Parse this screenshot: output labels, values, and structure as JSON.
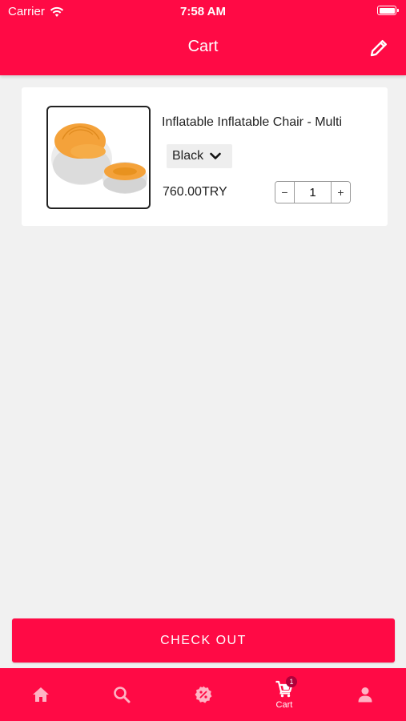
{
  "status_bar": {
    "carrier": "Carrier",
    "time": "7:58 AM"
  },
  "header": {
    "title": "Cart",
    "edit_icon": "pencil-icon"
  },
  "cart_items": [
    {
      "name": "Inflatable Inflatable Chair - Multi",
      "variant": "Black",
      "price": "760.00TRY",
      "quantity": "1",
      "minus_label": "−",
      "plus_label": "+"
    }
  ],
  "checkout_label": "CHECK OUT",
  "tabbar": {
    "items": [
      {
        "icon": "home-icon",
        "label": ""
      },
      {
        "icon": "search-icon",
        "label": ""
      },
      {
        "icon": "discount-badge-icon",
        "label": ""
      },
      {
        "icon": "cart-icon",
        "label": "Cart",
        "badge": "1",
        "active": true
      },
      {
        "icon": "profile-icon",
        "label": ""
      }
    ]
  },
  "colors": {
    "primary": "#ff0a45",
    "background": "#f1f1f1",
    "tab_inactive": "#ffb3c4"
  }
}
